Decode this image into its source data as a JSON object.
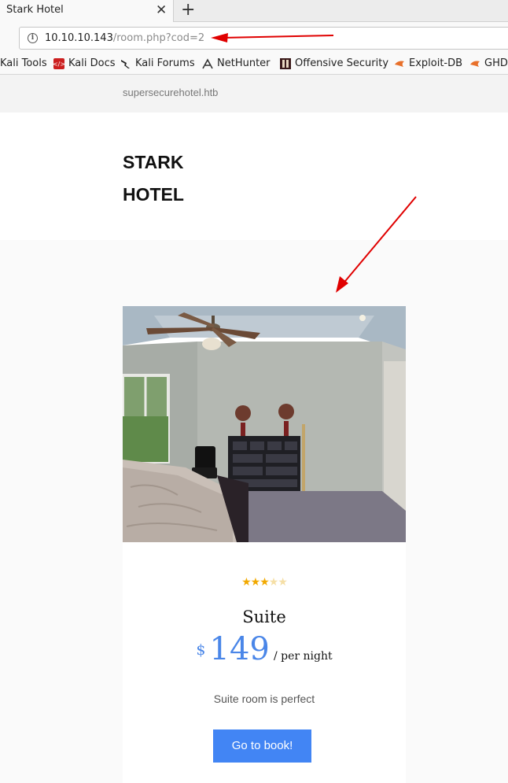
{
  "browser": {
    "tab_title": "Stark Hotel",
    "tab_close": "✕",
    "new_tab": "+",
    "url_host": "10.10.10.143",
    "url_path": "/room.php?cod=2",
    "bookmarks": [
      "Kali Tools",
      "Kali Docs",
      "Kali Forums",
      "NetHunter",
      "Offensive Security",
      "Exploit-DB",
      "GHDB"
    ]
  },
  "site": {
    "domain": "supersecurehotel.htb",
    "brand_line1": "STARK",
    "brand_line2": "HOTEL"
  },
  "room": {
    "rating": 3,
    "max_rating": 5,
    "name": "Suite",
    "currency": "$",
    "price": "149",
    "per": "/ per night",
    "description": "Suite room is perfect",
    "book_label": "Go to book!"
  },
  "colors": {
    "accent": "#4285f4",
    "price": "#4a86e8",
    "annotation_arrow": "#e00000"
  }
}
